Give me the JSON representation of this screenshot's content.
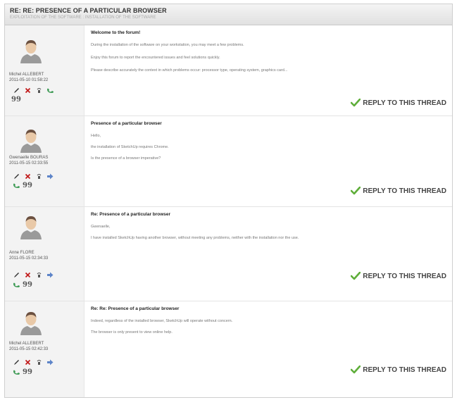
{
  "thread": {
    "title": "RE: RE: PRESENCE OF A PARTICULAR BROWSER",
    "breadcrumb": "EXPLOITATION OF THE SOFTWARE : INSTALLATION OF THE SOFTWARE"
  },
  "reply_label": "REPLY TO THIS THREAD",
  "colors": {
    "reply_check": "#5fae3a",
    "delete": "#c21d1d",
    "arrow": "#5d84c8",
    "phone": "#3d9a54"
  },
  "posts": [
    {
      "author": "Michel ALLEBERT",
      "date": "2011-05-10 01:58:22",
      "subject": "Welcome to the forum!",
      "lines": [
        "During the installation of the software on your workstation, you may meet a few problems.",
        "Enjoy this forum to report the encountered issues and feel solutions quickly.",
        "Please describe accurately the context in which problems occur: processor type, operating system, graphics card..."
      ]
    },
    {
      "author": "Gwenaelle BOURAS",
      "date": "2011-05-15 02:33:55",
      "subject": "Presence of a particular browser",
      "lines": [
        "Hello,",
        "the installation of SketchUp requires Chrome.",
        "Is the presence of a browser imperative?"
      ]
    },
    {
      "author": "Anne FLORE",
      "date": "2011-05-15 02:34:33",
      "subject": "Re: Presence of a particular browser",
      "lines": [
        "Gwenaelle,",
        "I have installed SketchUp having another browser, without meeting any problems, neither with the installation nor the use."
      ]
    },
    {
      "author": "Michel ALLEBERT",
      "date": "2011-05-15 02:42:33",
      "subject": "Re: Re: Presence of a particular browser",
      "lines": [
        "Indeed, regardless of the installed browser, SketchUp will operate without concern.",
        "The browser is only present to view online help."
      ]
    }
  ]
}
